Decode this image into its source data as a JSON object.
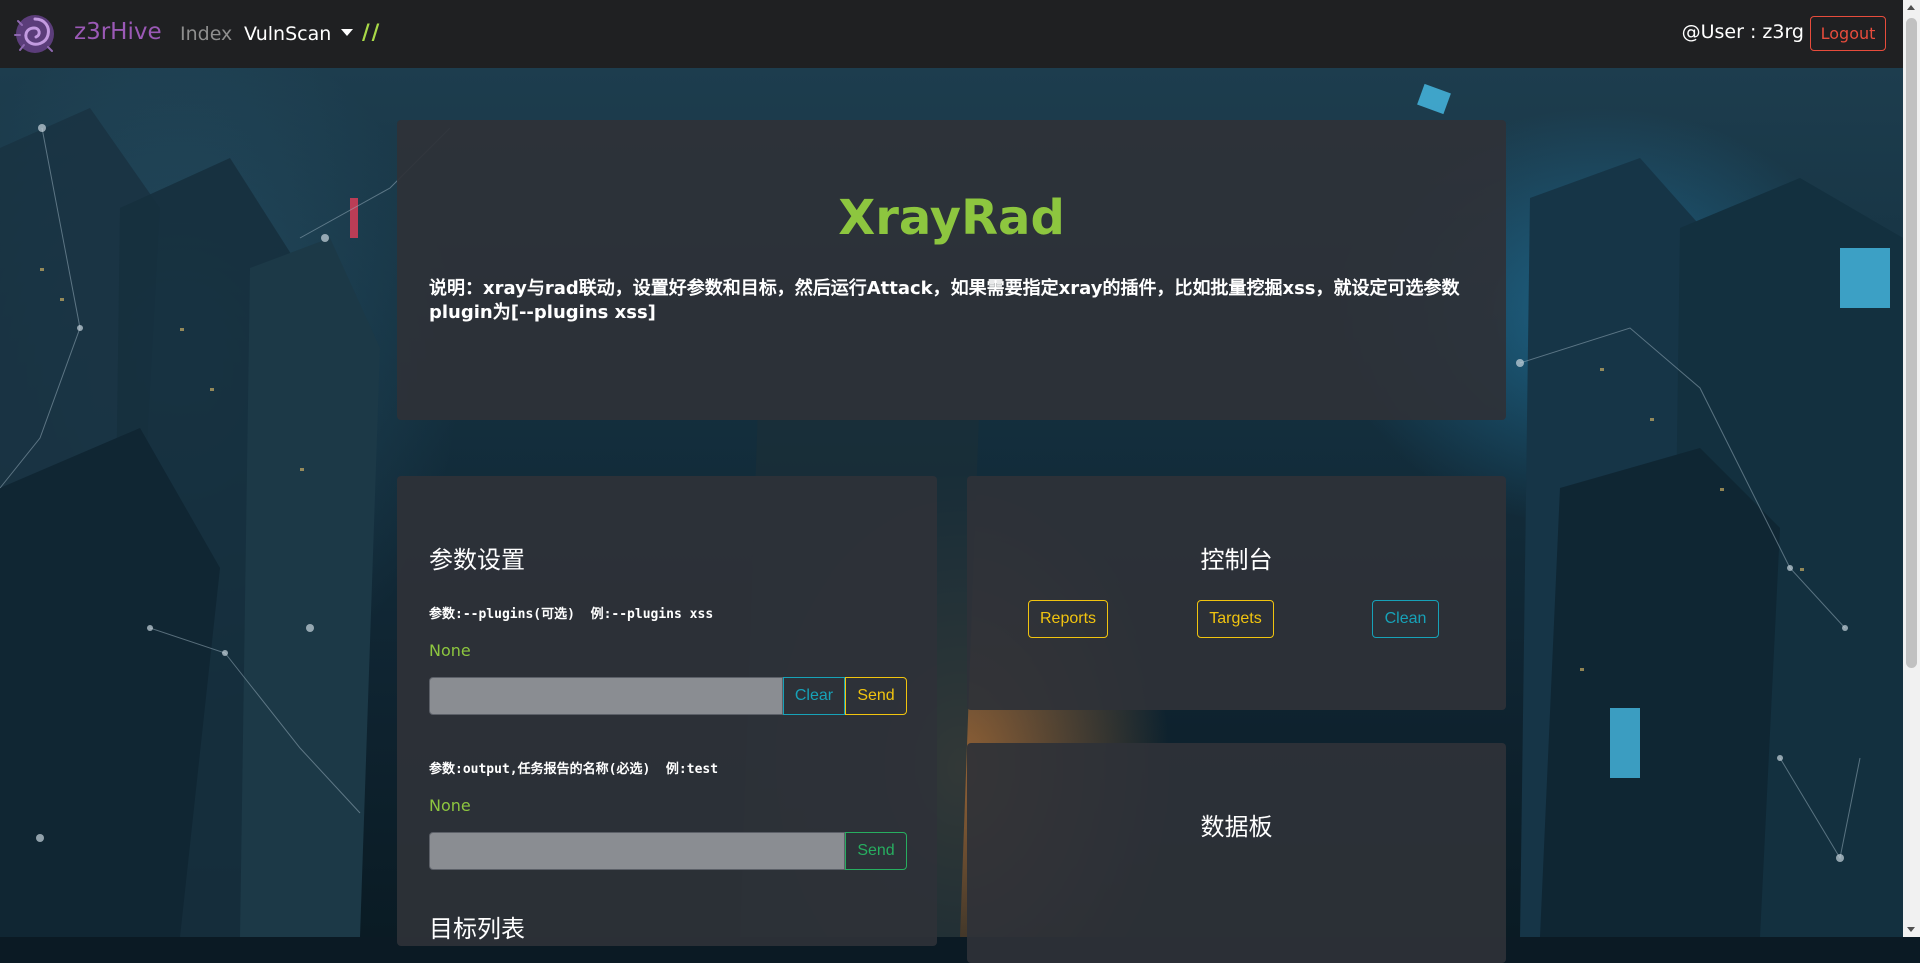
{
  "navbar": {
    "brand": "z3rHive",
    "index_label": "Index",
    "vulnscan_label": "VulnScan",
    "slash_label": "//",
    "user_label": "@User : z3rg",
    "logout_label": "Logout"
  },
  "hero": {
    "title": "XrayRad",
    "description": "说明：xray与rad联动，设置好参数和目标，然后运行Attack，如果需要指定xray的插件，比如批量挖掘xss，就设定可选参数plugin为[--plugins xss]"
  },
  "params_panel": {
    "heading": "参数设置",
    "plugins_label": "参数:--plugins(可选)  例:--plugins xss",
    "plugins_value": "None",
    "plugins_clear_label": "Clear",
    "plugins_send_label": "Send",
    "output_label": "参数:output,任务报告的名称(必选)  例:test",
    "output_value": "None",
    "output_send_label": "Send",
    "targets_heading": "目标列表"
  },
  "console_panel": {
    "heading": "控制台",
    "reports_label": "Reports",
    "targets_label": "Targets",
    "clean_label": "Clean"
  },
  "databoard_panel": {
    "heading": "数据板"
  },
  "colors": {
    "brand": "#9b59b6",
    "accent_green": "#8dc63f",
    "warning_yellow": "#f1c40f",
    "info_cyan": "#17a2b8",
    "success_green": "#27ae60",
    "danger_red": "#e74c3c",
    "navbar_bg": "#1f2022",
    "panel_bg": "#2e3138"
  },
  "icons": {
    "logo": "zerg-hive-logo-icon",
    "dropdown": "caret-down-icon"
  }
}
